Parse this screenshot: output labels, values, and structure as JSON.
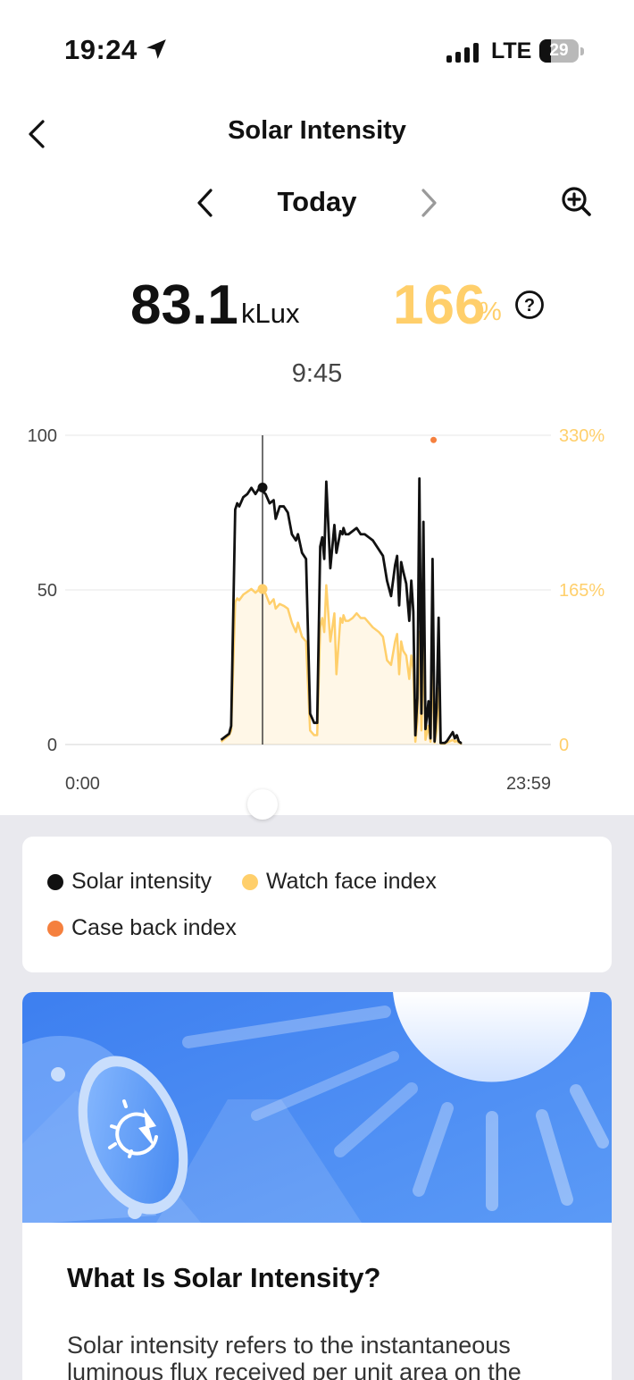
{
  "status_bar": {
    "time": "19:24",
    "network": "LTE",
    "battery": "29",
    "battery_level": 0.29
  },
  "header": {
    "title": "Solar Intensity"
  },
  "date_nav": {
    "label": "Today"
  },
  "metrics": {
    "intensity_value": "83.1",
    "intensity_unit": "kLux",
    "index_value": "166",
    "index_unit": "%",
    "selected_time": "9:45"
  },
  "colors": {
    "intensity": "#111111",
    "watch_face": "#ffcf6b",
    "case_back": "#f5803e",
    "banner": "#4a8df2"
  },
  "chart_data": {
    "type": "line",
    "x_range": [
      "0:00",
      "23:59"
    ],
    "y_left": {
      "ticks": [
        "100",
        "50",
        "0"
      ],
      "min": 0,
      "max": 100
    },
    "y_right": {
      "ticks": [
        "330%",
        "165%",
        "0"
      ],
      "min": 0,
      "max": 330
    },
    "selected": {
      "x": "9:45",
      "intensity": 83.1,
      "watch_face_index": 166
    },
    "series": [
      {
        "name": "Solar intensity",
        "x": [
          7.7,
          8.1,
          8.2,
          8.4,
          8.5,
          8.6,
          8.8,
          9.0,
          9.2,
          9.4,
          9.6,
          9.75,
          9.9,
          10.1,
          10.3,
          10.4,
          10.6,
          10.8,
          11.0,
          11.2,
          11.4,
          11.5,
          11.7,
          11.9,
          12.1,
          12.3,
          12.45,
          12.6,
          12.7,
          12.8,
          12.9,
          13.1,
          13.3,
          13.4,
          13.6,
          13.7,
          13.75,
          13.85,
          14.0,
          14.2,
          14.4,
          14.6,
          14.8,
          15.0,
          15.2,
          15.5,
          15.7,
          15.9,
          16.1,
          16.3,
          16.4,
          16.5,
          16.6,
          16.7,
          16.85,
          17.0,
          17.1,
          17.2,
          17.3,
          17.4,
          17.5,
          17.6,
          17.7,
          17.8,
          17.95,
          18.05,
          18.15,
          18.25,
          18.35,
          18.45,
          18.55,
          18.65,
          18.75,
          18.85,
          18.95,
          19.05,
          19.15,
          19.25,
          19.35,
          19.45,
          19.55,
          19.6
        ],
        "values": [
          1.5,
          3.5,
          6,
          76,
          78,
          77,
          80,
          81,
          83,
          81,
          83.1,
          82,
          81,
          78,
          79,
          73,
          77,
          77,
          75,
          68,
          66,
          68,
          62,
          60,
          10,
          7,
          7,
          64,
          67,
          60,
          85,
          57,
          71,
          62,
          69,
          68,
          70,
          68,
          68,
          69,
          70,
          68,
          68,
          67,
          66,
          63,
          61,
          53,
          48,
          58,
          61,
          45,
          59,
          56,
          52,
          40,
          53,
          43,
          3,
          15,
          86,
          10,
          72,
          5,
          14,
          2,
          60,
          1,
          12,
          41,
          0.5,
          0.5,
          0.5,
          1,
          2,
          3,
          4,
          2,
          3,
          1,
          0.5,
          0.5
        ]
      },
      {
        "name": "Watch face index",
        "x": [
          7.7,
          8.1,
          8.2,
          8.4,
          8.5,
          8.6,
          8.8,
          9.0,
          9.2,
          9.4,
          9.6,
          9.75,
          9.9,
          10.1,
          10.3,
          10.4,
          10.6,
          10.8,
          11.0,
          11.2,
          11.4,
          11.5,
          11.7,
          11.9,
          12.1,
          12.3,
          12.45,
          12.6,
          12.7,
          12.8,
          12.9,
          13.1,
          13.3,
          13.4,
          13.6,
          13.7,
          13.75,
          13.85,
          14.0,
          14.2,
          14.4,
          14.6,
          14.8,
          15.0,
          15.2,
          15.5,
          15.7,
          15.9,
          16.1,
          16.3,
          16.4,
          16.5,
          16.6,
          16.7,
          16.85,
          17.0,
          17.1,
          17.2,
          17.3,
          17.4,
          17.5,
          17.6,
          17.7,
          17.8,
          17.95,
          18.05,
          18.15,
          18.25,
          18.35,
          18.45,
          18.55,
          18.65,
          18.75,
          18.85,
          18.95,
          19.05,
          19.15,
          19.25,
          19.35,
          19.45,
          19.55,
          19.6
        ],
        "values": [
          3,
          10,
          15,
          152,
          156,
          154,
          160,
          163,
          166,
          162,
          166,
          163,
          161,
          150,
          155,
          145,
          150,
          148,
          145,
          130,
          120,
          130,
          115,
          110,
          15,
          10,
          10,
          125,
          135,
          120,
          170,
          110,
          140,
          75,
          135,
          130,
          138,
          132,
          132,
          135,
          140,
          135,
          135,
          130,
          125,
          120,
          115,
          90,
          85,
          110,
          118,
          75,
          110,
          100,
          95,
          70,
          95,
          80,
          3,
          25,
          120,
          15,
          105,
          5,
          20,
          3,
          85,
          2,
          15,
          60,
          1,
          1,
          1,
          2,
          3,
          4,
          5,
          3,
          4,
          2,
          1,
          1
        ]
      },
      {
        "name": "Case back index",
        "x": [
          18.2
        ],
        "values": [
          325
        ]
      }
    ]
  },
  "legend": {
    "solar_intensity": "Solar intensity",
    "watch_face_index": "Watch face index",
    "case_back_index": "Case back index"
  },
  "info": {
    "title": "What Is Solar Intensity?",
    "body": "Solar intensity refers to the instantaneous luminous flux received per unit area on the"
  }
}
